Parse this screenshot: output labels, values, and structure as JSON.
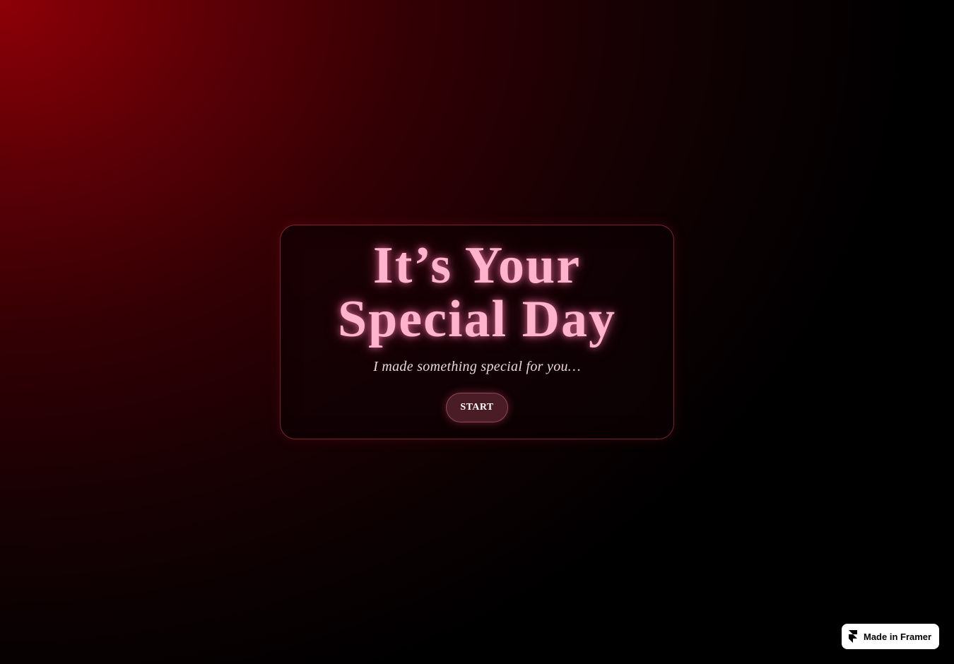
{
  "hero": {
    "title_line1": "It’s Your",
    "title_line2": "Special Day",
    "subtitle": "I made something special for you…",
    "start_label": "START"
  },
  "badge": {
    "label": "Made in Framer",
    "icon": "framer-logo-icon"
  },
  "colors": {
    "title": "#ffb3cc",
    "background_top_left": "#8e0007",
    "background_bottom_right": "#000000",
    "button_bg": "#4a1c25",
    "card_border": "#d23c5a"
  }
}
